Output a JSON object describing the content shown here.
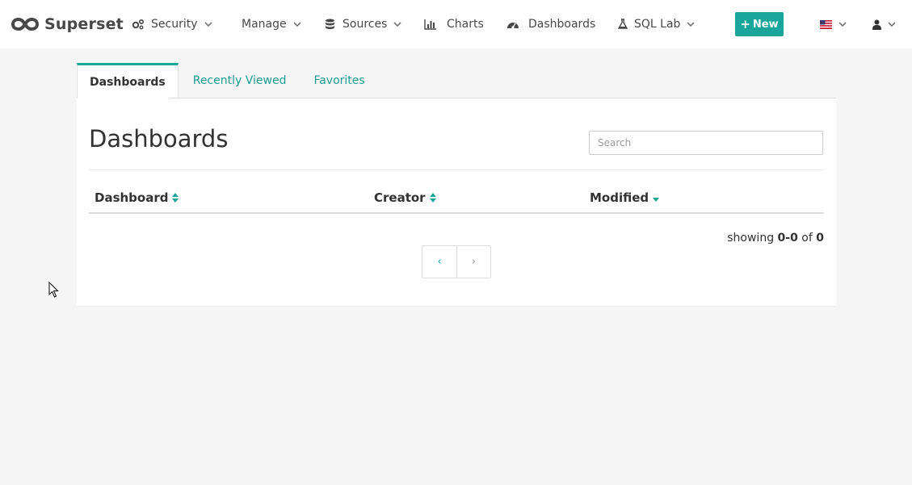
{
  "brand": {
    "name": "Superset"
  },
  "nav": {
    "security": "Security",
    "manage": "Manage",
    "sources": "Sources",
    "charts": "Charts",
    "dashboards": "Dashboards",
    "sqllab": "SQL Lab",
    "new_button": "New"
  },
  "tabs": [
    {
      "label": "Dashboards",
      "active": true
    },
    {
      "label": "Recently Viewed",
      "active": false
    },
    {
      "label": "Favorites",
      "active": false
    }
  ],
  "page": {
    "title": "Dashboards",
    "search_placeholder": "Search"
  },
  "table": {
    "columns": [
      "Dashboard",
      "Creator",
      "Modified"
    ],
    "rows": []
  },
  "pagination": {
    "showing_prefix": "showing",
    "range": "0-0",
    "of_word": "of",
    "total": "0",
    "prev": "‹",
    "next": "›"
  },
  "colors": {
    "accent": "#1aa59a"
  },
  "icons": [
    "superset-logo",
    "gears-icon",
    "database-icon",
    "bar-chart-icon",
    "dashboard-gauge-icon",
    "flask-icon",
    "us-flag-icon",
    "user-icon",
    "chevron-down-icon",
    "sort-icon",
    "sort-desc-icon"
  ]
}
